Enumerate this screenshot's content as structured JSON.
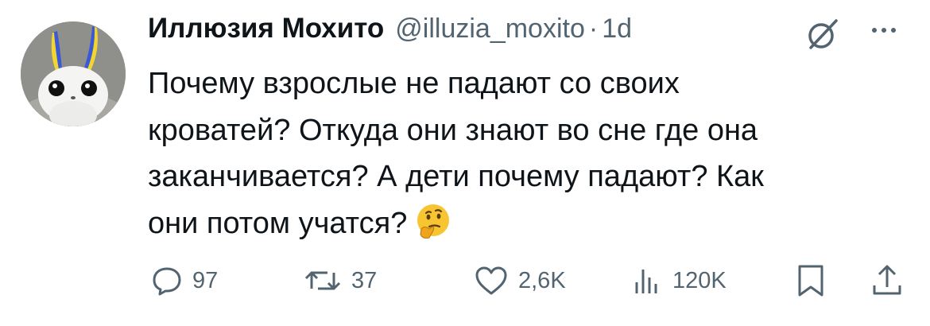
{
  "tweet": {
    "author_name": "Иллюзия Мохито",
    "handle": "@illuzia_moxito",
    "separator": "·",
    "time": "1d",
    "text": "Почему взрослые не падают со своих\nкроватей? Откуда они знают во сне где она\nзаканчивается? А дети почему падают? Как\nони потом учатся?",
    "emoji": "thinking-face"
  },
  "actions": {
    "replies": "97",
    "reposts": "37",
    "likes": "2,6K",
    "views": "120K"
  },
  "icons": {
    "reply": "speech-bubble-icon",
    "repost": "repost-arrows-icon",
    "like": "heart-icon",
    "views": "bar-chart-icon",
    "bookmark": "bookmark-icon",
    "share": "share-upload-icon",
    "grok": "grok-icon",
    "more": "more-dots-icon"
  },
  "colors": {
    "text": "#0f1419",
    "secondary": "#536471",
    "background": "#ffffff"
  }
}
